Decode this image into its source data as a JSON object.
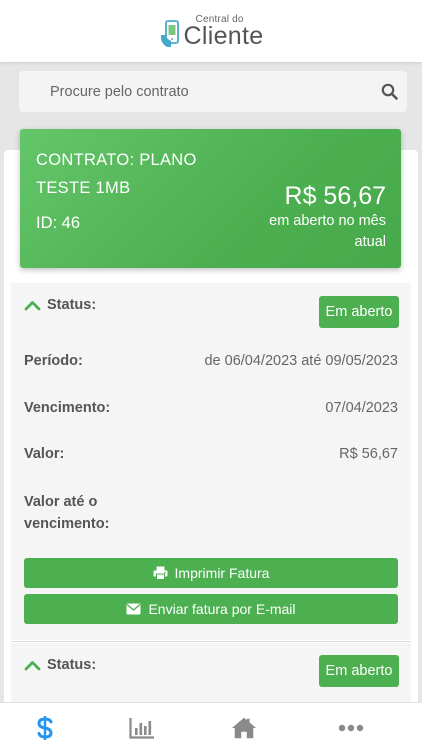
{
  "header": {
    "logo_small": "Central do",
    "logo_big": "Cliente"
  },
  "search": {
    "placeholder": "Procure pelo contrato",
    "value": ""
  },
  "contract": {
    "name": "CONTRATO: PLANO TESTE 1MB",
    "id": "ID: 46",
    "amount": "R$ 56,67",
    "note": "em aberto no mês atual"
  },
  "invoice1": {
    "status_label": "Status:",
    "status_badge": "Em aberto",
    "period_label": "Período:",
    "period_value": "de 06/04/2023 até 09/05/2023",
    "due_label": "Vencimento:",
    "due_value": "07/04/2023",
    "value_label": "Valor:",
    "value_value": "R$ 56,67",
    "value_until_due_label": "Valor até o vencimento:",
    "print_button": "Imprimir Fatura",
    "email_button": "Enviar fatura por E-mail"
  },
  "invoice2": {
    "status_label": "Status:",
    "status_badge": "Em aberto"
  },
  "nav": {
    "active": "financeiro",
    "items": [
      "dollar-icon",
      "chart-icon",
      "home-icon",
      "more-icon"
    ]
  },
  "colors": {
    "accent": "#4caf50",
    "active_nav": "#2196f3",
    "inactive_nav": "#8a8a8a"
  }
}
